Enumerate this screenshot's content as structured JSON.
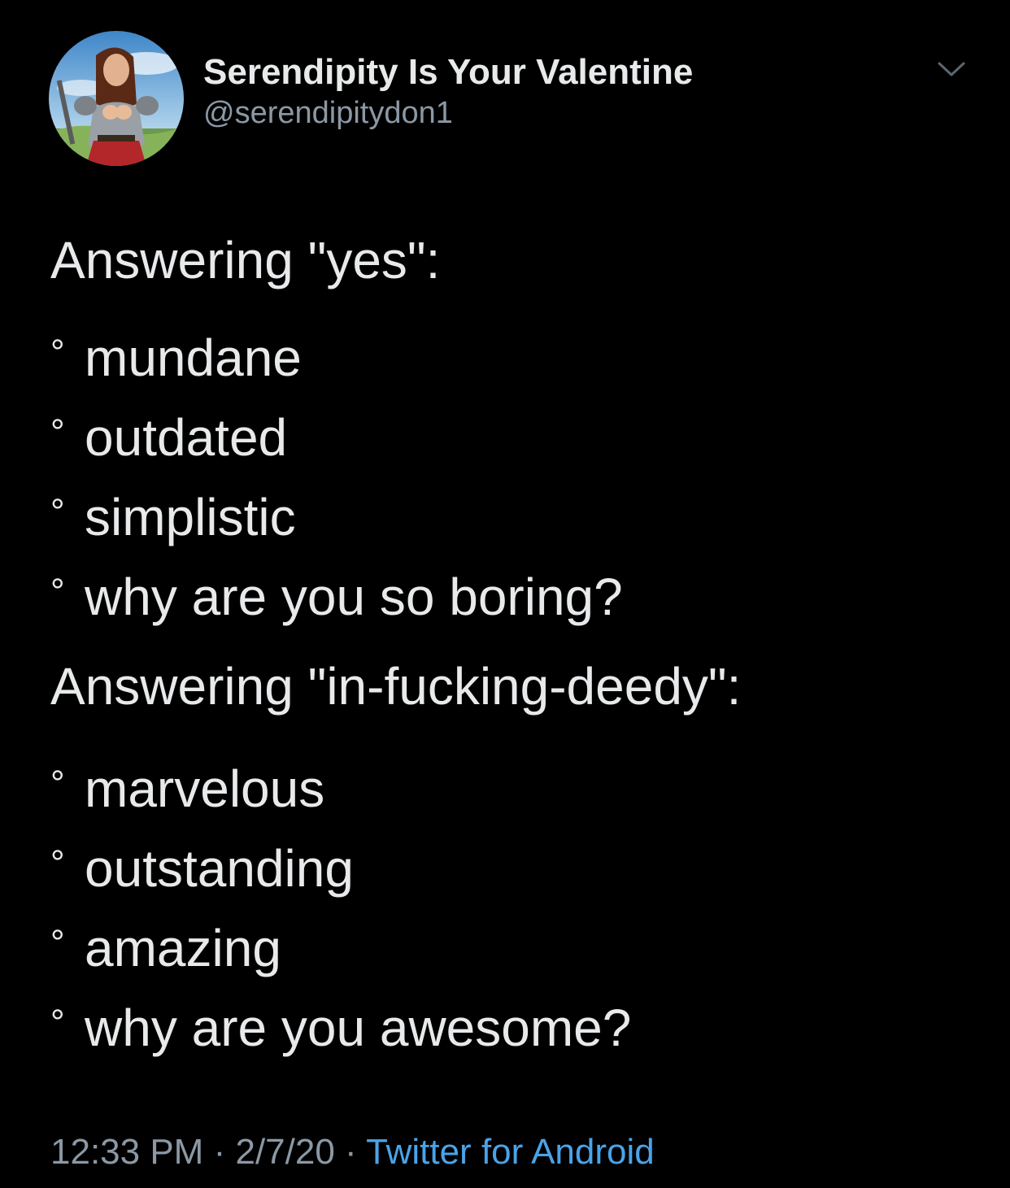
{
  "author": {
    "display_name": "Serendipity Is Your Valentine",
    "handle": "@serendipitydon1",
    "avatar_icon": "avatar-illustrated-warrior-woman"
  },
  "menu": {
    "icon": "chevron-down-icon"
  },
  "content": {
    "section_yes": {
      "heading": "Answering \"yes\":",
      "items": [
        "mundane",
        "outdated",
        "simplistic",
        "why are you so boring?"
      ]
    },
    "section_deedy": {
      "heading": "Answering \"in-fucking-deedy\":",
      "items": [
        "marvelous",
        "outstanding",
        "amazing",
        "why are you awesome?"
      ]
    },
    "bullet": "°"
  },
  "meta": {
    "time": "12:33 PM",
    "separator": "·",
    "date": "2/7/20",
    "source": "Twitter for Android"
  },
  "colors": {
    "background": "#000000",
    "text": "#e7e9ea",
    "secondary": "#8b98a5",
    "link": "#4aa3e8"
  }
}
